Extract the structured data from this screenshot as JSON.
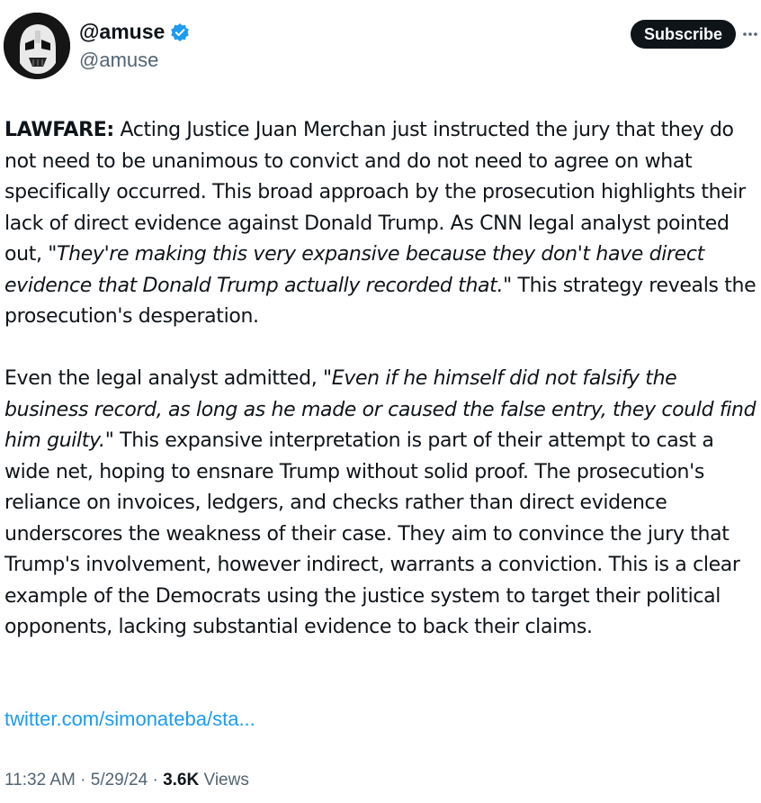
{
  "author": {
    "display_name": "@amuse",
    "handle": "@amuse",
    "verified": true,
    "avatar_icon": "stormtrooper-avatar"
  },
  "header": {
    "subscribe_label": "Subscribe",
    "more_icon": "more-icon"
  },
  "tweet": {
    "p1_lead": "LAWFARE:",
    "p1_text_a": " Acting Justice Juan Merchan just instructed the jury that they do not need to be unanimous to convict and do not need to agree on what specifically occurred. This broad approach by the prosecution highlights their lack of direct evidence against Donald Trump. As CNN legal analyst pointed out, ",
    "p1_quote": "\"They're making this very expansive because they don't have direct evidence that Donald Trump actually recorded that.\"",
    "p1_text_b": " This strategy reveals the prosecution's desperation.",
    "p2_text_a": "Even the legal analyst admitted, ",
    "p2_quote": "\"Even if he himself did not falsify the business record, as long as he made or caused the false entry, they could find him guilty.\"",
    "p2_text_b": " This expansive interpretation is part of their attempt to cast a wide net, hoping to ensnare Trump without solid proof. The prosecution's reliance on invoices, ledgers, and checks rather than direct evidence underscores the weakness of their case. They aim to convince the jury that Trump's involvement, however indirect, warrants a conviction. This is a clear example of the Democrats using the justice system to target their political opponents, lacking substantial evidence to back their claims.",
    "link_text": "twitter.com/simonateba/sta..."
  },
  "meta": {
    "time": "11:32 AM",
    "separator": "·",
    "date": "5/29/24",
    "views_count": "3.6K",
    "views_label": "Views"
  },
  "colors": {
    "text": "#0f1419",
    "secondary": "#536471",
    "link": "#1d9bf0",
    "verified_badge": "#1d9bf0",
    "subscribe_bg": "#0f1419"
  }
}
